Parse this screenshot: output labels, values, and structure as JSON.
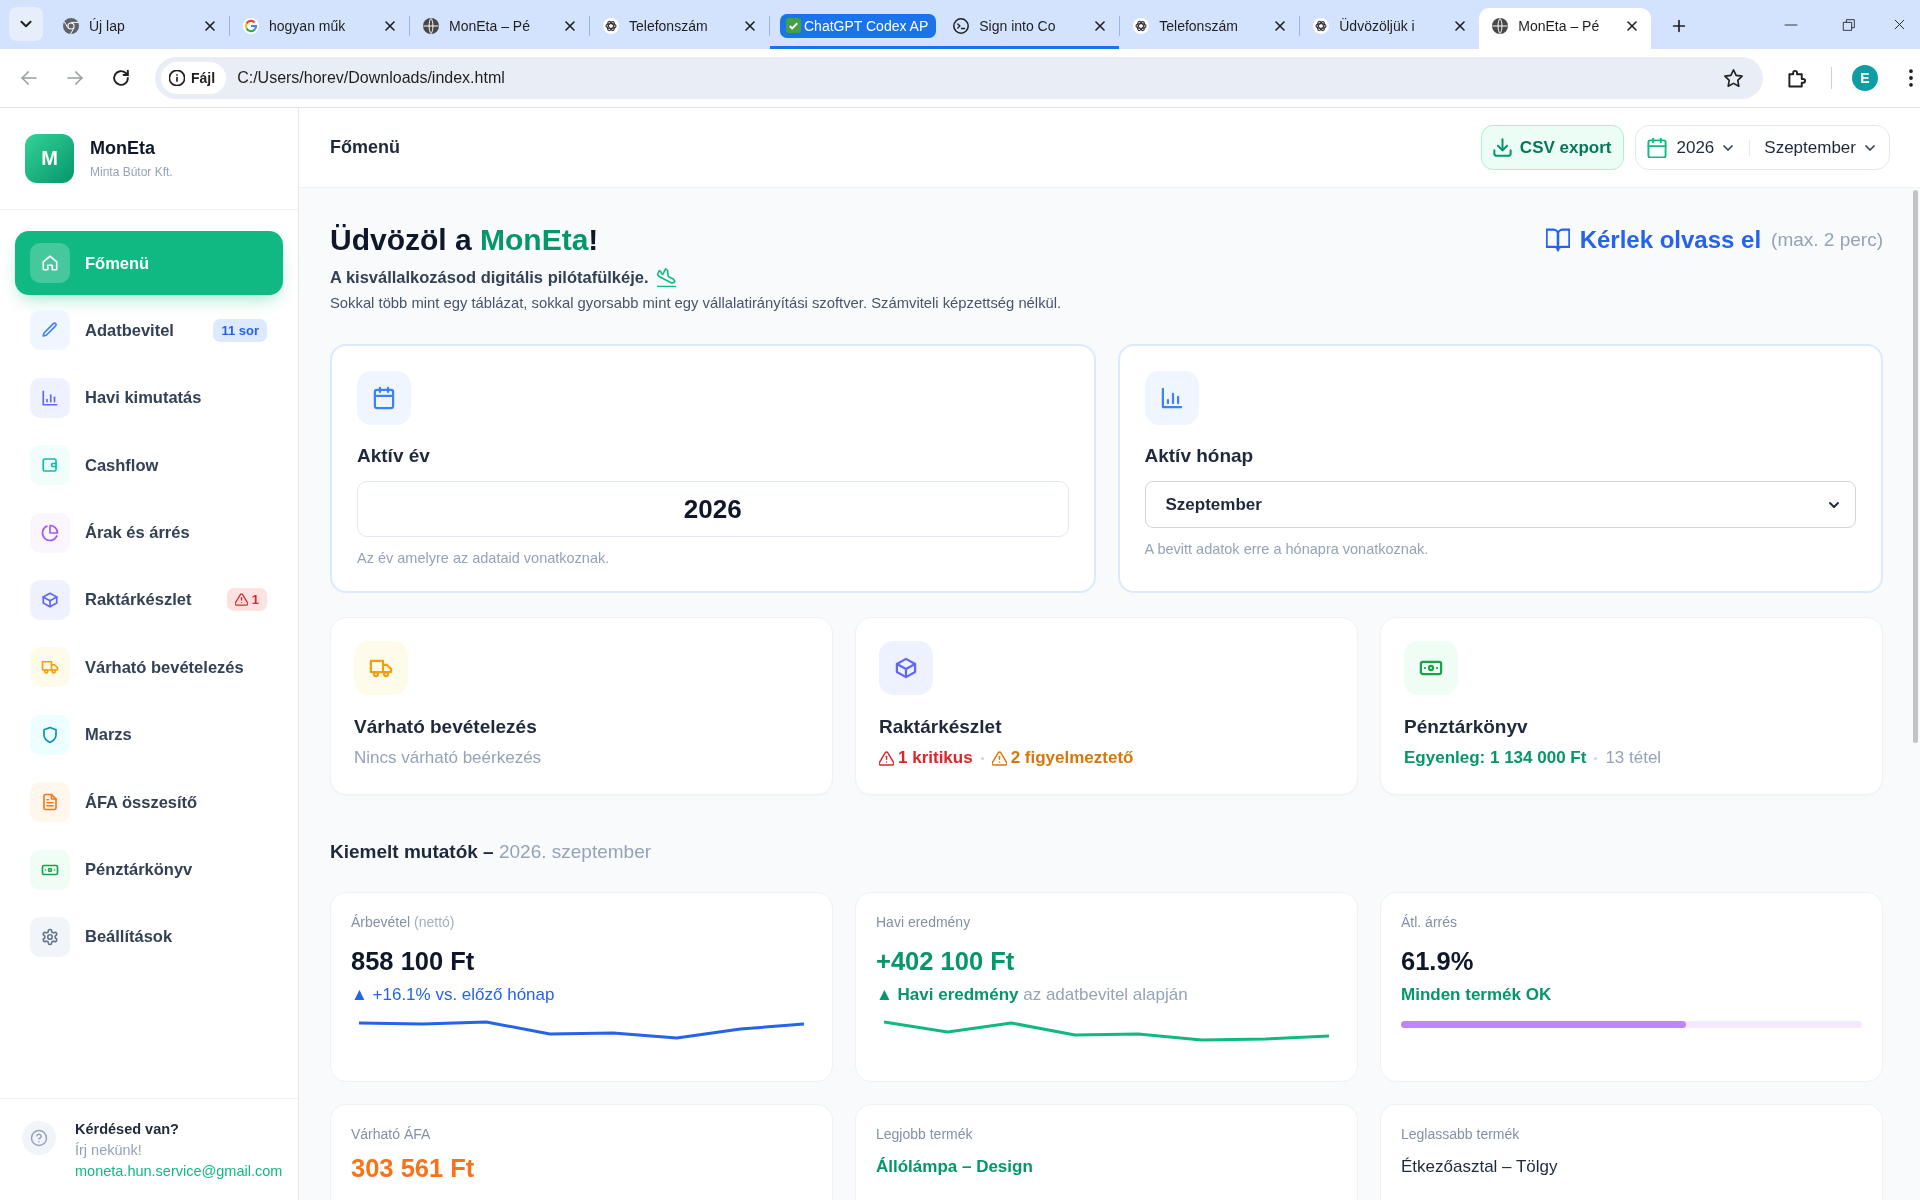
{
  "browser": {
    "tabs": [
      {
        "title": "Új lap",
        "selected": false,
        "grouped": false
      },
      {
        "title": "hogyan műk",
        "selected": false,
        "grouped": false
      },
      {
        "title": "MonEta – Pé",
        "selected": false,
        "grouped": false
      },
      {
        "title": "Telefonszám",
        "selected": false,
        "grouped": false
      },
      {
        "title": "Sign into Co",
        "selected": false,
        "grouped": true
      },
      {
        "title": "Telefonszám",
        "selected": false,
        "grouped": false
      },
      {
        "title": "Üdvözöljük i",
        "selected": false,
        "grouped": false
      },
      {
        "title": "MonEta – Pé",
        "selected": true,
        "grouped": false
      }
    ],
    "tab_group_label": "ChatGPT Codex AP",
    "security_chip": "Fájl",
    "url": "C:/Users/horev/Downloads/index.html",
    "profile_initial": "E"
  },
  "sidebar": {
    "brand": {
      "logo_letter": "M",
      "name": "MonEta",
      "company": "Minta Bútor Kft."
    },
    "items": [
      {
        "label": "Főmenü",
        "selected": true
      },
      {
        "label": "Adatbevitel",
        "selected": false,
        "badge": {
          "kind": "count",
          "text": "11 sor"
        }
      },
      {
        "label": "Havi kimutatás",
        "selected": false
      },
      {
        "label": "Cashflow",
        "selected": false
      },
      {
        "label": "Árak és árrés",
        "selected": false
      },
      {
        "label": "Raktárkészlet",
        "selected": false,
        "badge": {
          "kind": "alert",
          "text": "1"
        }
      },
      {
        "label": "Várható bevételezés",
        "selected": false
      },
      {
        "label": "Marzs",
        "selected": false
      },
      {
        "label": "ÁFA összesítő",
        "selected": false
      },
      {
        "label": "Pénztárkönyv",
        "selected": false
      },
      {
        "label": "Beállítások",
        "selected": false
      }
    ],
    "help": {
      "title": "Kérdésed van?",
      "subtitle": "Írj nekünk!",
      "email": "moneta.hun.service@gmail.com"
    }
  },
  "header": {
    "title": "Főmenü",
    "export_button": "CSV export",
    "period": {
      "year": "2026",
      "month": "Szeptember"
    }
  },
  "welcome": {
    "title": {
      "before": "Üdvözöl a",
      "highlight": "MonEta",
      "after": "!"
    },
    "tagline": "A kisvállalkozásod digitális pilótafülkéje.",
    "description": "Sokkal több mint egy táblázat, sokkal gyorsabb mint egy vállalatirányítási szoftver. Számviteli képzettség nélkül.",
    "read_link": {
      "label": "Kérlek olvass el",
      "note": "(max. 2 perc)"
    }
  },
  "settings_cards": [
    {
      "kind": "input",
      "title": "Aktív év",
      "value": "2026",
      "hint": "Az év amelyre az adataid vonatkoznak."
    },
    {
      "kind": "select",
      "title": "Aktív hónap",
      "value": "Szeptember",
      "hint": "A bevitt adatok erre a hónapra vonatkoznak."
    }
  ],
  "summary_cards": [
    {
      "title": "Várható bevételezés",
      "details": [
        {
          "kind": "muted",
          "text": "Nincs várható beérkezés"
        }
      ]
    },
    {
      "title": "Raktárkészlet",
      "details": [
        {
          "kind": "critical",
          "text": "1 kritikus"
        },
        {
          "kind": "warning",
          "text": "2 figyelmeztető"
        }
      ]
    },
    {
      "title": "Pénztárkönyv",
      "details": [
        {
          "kind": "positive",
          "text": "Egyenleg: 1 134 000 Ft"
        },
        {
          "kind": "muted",
          "text": "13 tétel"
        }
      ]
    }
  ],
  "highlights": {
    "title": "Kiemelt mutatók –",
    "period": "2026. szeptember",
    "kpis": [
      {
        "kind": "trend",
        "label": "Árbevétel",
        "label_note": "(nettó)",
        "value": "858 100 Ft",
        "note": "▲ +16.1% vs. előző hónap"
      },
      {
        "kind": "result",
        "label": "Havi eredmény",
        "value": "+402 100 Ft",
        "note": "**▲ Havi eredmény** az adatbevitel alapján"
      },
      {
        "kind": "progress",
        "label": "Átl. árrés",
        "value": "61.9%",
        "note": "Minden termék OK",
        "level": 0.619
      },
      {
        "kind": "alert",
        "label": "Várható ÁFA",
        "value": "303 561 Ft"
      },
      {
        "kind": "best",
        "label": "Legjobb termék",
        "value": "Állólámpa – Design"
      },
      {
        "kind": "slowest",
        "label": "Leglassabb termék",
        "value": "Étkezőasztal – Tölgy"
      }
    ]
  }
}
